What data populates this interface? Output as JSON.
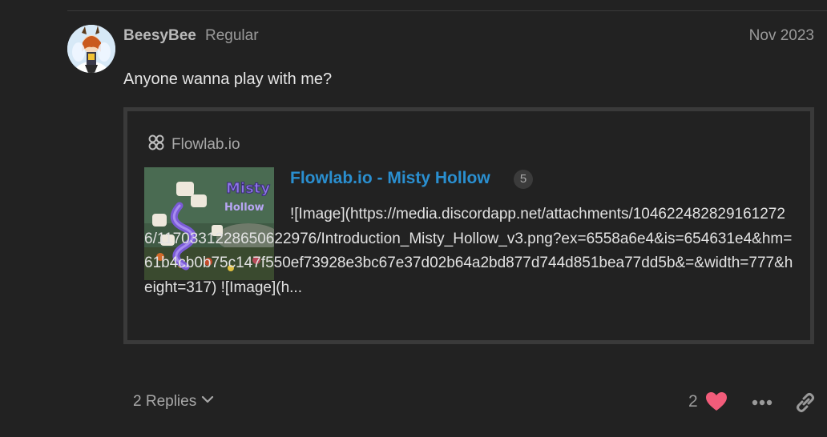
{
  "post": {
    "username": "BeesyBee",
    "user_title": "Regular",
    "date": "Nov 2023",
    "text": "Anyone wanna play with me?"
  },
  "onebox": {
    "site_name": "Flowlab.io",
    "title": "Flowlab.io - Misty Hollow",
    "click_count": "5",
    "excerpt": "![Image](https://media.discordapp.net/attachments/1046224828291612726/1170331228650622976/Introduction_Misty_Hollow_v3.png?ex=6558a6e4&is=654631e4&hm=61b4cb0b75c147f550ef73928e3bc67e37d02b64a2bd877d744d851bea77dd5b&=&width=777&height=317) ![Image](h..."
  },
  "actions": {
    "replies_label": "2 Replies",
    "like_count": "2"
  },
  "colors": {
    "background": "#222222",
    "link": "#2a8fd0",
    "heart": "#f25c7a"
  },
  "icons": {
    "site": "flowlab-icon",
    "replies": "chevron-down-icon",
    "like": "heart-icon",
    "more": "ellipsis-icon",
    "share": "link-icon"
  }
}
